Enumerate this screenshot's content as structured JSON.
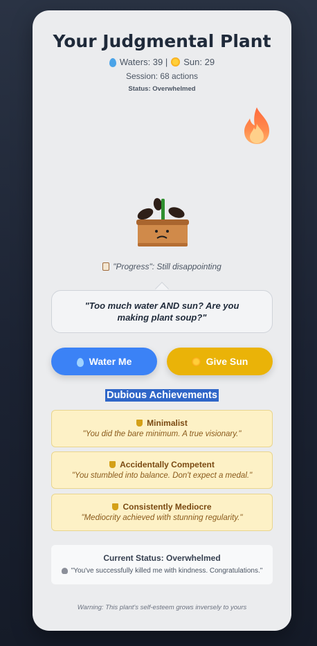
{
  "header": {
    "title": "Your Judgmental Plant",
    "waters_text": "Waters: 39 |",
    "sun_text": "Sun: 29",
    "session": "Session: 68 actions",
    "status": "Status: Overwhelmed"
  },
  "progress_text": "\"Progress\": Still disappointing",
  "speech": "\"Too much water AND sun? Are you making plant soup?\"",
  "buttons": {
    "water": "Water Me",
    "sun": "Give Sun"
  },
  "achievements": {
    "title": "Dubious Achievements",
    "items": [
      {
        "name": "Minimalist",
        "quote": "\"You did the bare minimum. A true visionary.\""
      },
      {
        "name": "Accidentally Competent",
        "quote": "\"You stumbled into balance. Don't expect a medal.\""
      },
      {
        "name": "Consistently Mediocre",
        "quote": "\"Mediocrity achieved with stunning regularity.\""
      }
    ]
  },
  "current_status": {
    "heading": "Current Status: Overwhelmed",
    "quote": "\"You've successfully killed me with kindness. Congratulations.\""
  },
  "footer_warning": "Warning: This plant's self-esteem grows inversely to yours",
  "icons": {
    "water": "droplet-icon",
    "sun": "sun-icon",
    "flame": "fire-icon",
    "clipboard": "clipboard-icon",
    "trophy": "trophy-icon",
    "skull": "skull-icon"
  },
  "colors": {
    "water_button": "#3b82f6",
    "sun_button": "#eab308",
    "achievement_bg": "#fdf1c6",
    "highlight": "#2f66c8"
  }
}
